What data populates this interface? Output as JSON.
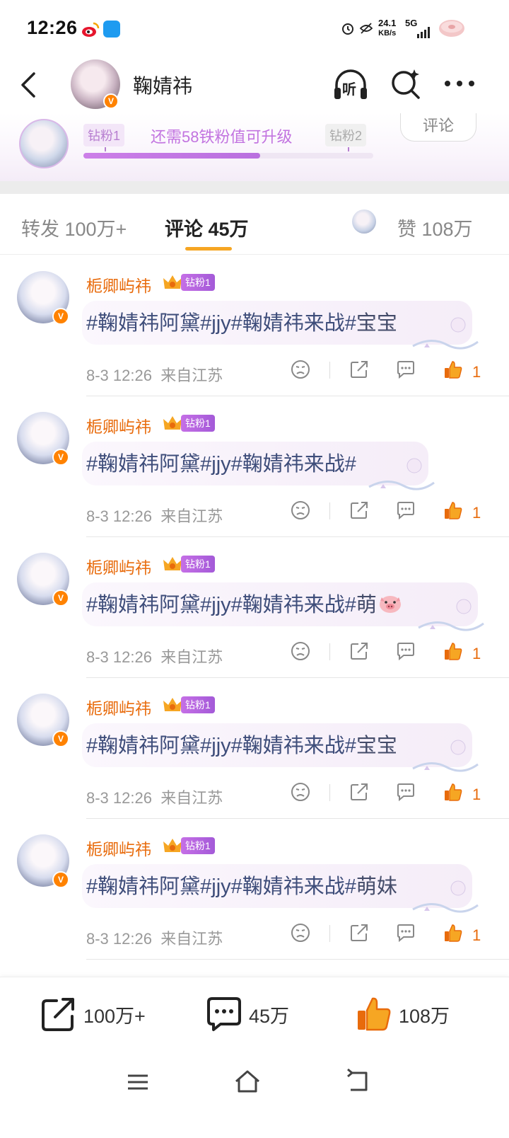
{
  "status_bar": {
    "time": "12:26",
    "net_speed_value": "24.1",
    "net_speed_unit": "KB/s",
    "network": "5G",
    "icons": [
      "weibo-icon",
      "app-icon",
      "alarm-icon",
      "eye-off-icon",
      "signal-icon",
      "donut-battery-icon"
    ]
  },
  "header": {
    "title": "鞠婧祎",
    "verified_badge": "V",
    "icons": [
      "back-icon",
      "listen-icon",
      "ai-search-icon",
      "more-icon"
    ],
    "listen_label": "听"
  },
  "fan_banner": {
    "level_current": "钻粉1",
    "level_next": "钻粉2",
    "hint": "还需58铁粉值可升级",
    "progress_percent": 61,
    "comment_button": "评论"
  },
  "tabs": {
    "repost": "转发 100万+",
    "comment": "评论 45万",
    "like": "赞 108万"
  },
  "comments": [
    {
      "name": "栀卿屿祎",
      "badge": "钻粉1",
      "text_prefix": "#鞠婧祎阿黛#jjy#鞠婧祎来战#",
      "text_suffix": "宝宝",
      "emoji": "",
      "time": "8-3 12:26",
      "location": "来自江苏",
      "likes": "1"
    },
    {
      "name": "栀卿屿祎",
      "badge": "钻粉1",
      "text_prefix": "#鞠婧祎阿黛#jjy#鞠婧祎来战#",
      "text_suffix": "",
      "emoji": "",
      "time": "8-3 12:26",
      "location": "来自江苏",
      "likes": "1"
    },
    {
      "name": "栀卿屿祎",
      "badge": "钻粉1",
      "text_prefix": "#鞠婧祎阿黛#jjy#鞠婧祎来战#",
      "text_suffix": "萌",
      "emoji": "pig-face-icon",
      "time": "8-3 12:26",
      "location": "来自江苏",
      "likes": "1"
    },
    {
      "name": "栀卿屿祎",
      "badge": "钻粉1",
      "text_prefix": "#鞠婧祎阿黛#jjy#鞠婧祎来战#",
      "text_suffix": "宝宝",
      "emoji": "",
      "time": "8-3 12:26",
      "location": "来自江苏",
      "likes": "1"
    },
    {
      "name": "栀卿屿祎",
      "badge": "钻粉1",
      "text_prefix": "#鞠婧祎阿黛#jjy#鞠婧祎来战#",
      "text_suffix": "萌妹",
      "emoji": "",
      "time": "8-3 12:26",
      "location": "来自江苏",
      "likes": "1"
    }
  ],
  "bottom_bar": {
    "repost_count": "100万+",
    "comment_count": "45万",
    "like_count": "108万"
  },
  "colors": {
    "accent_orange": "#e86b0c",
    "tab_indicator": "#f6a623",
    "fan_purple": "#c274e0",
    "topic_text": "#3e4d7a"
  }
}
